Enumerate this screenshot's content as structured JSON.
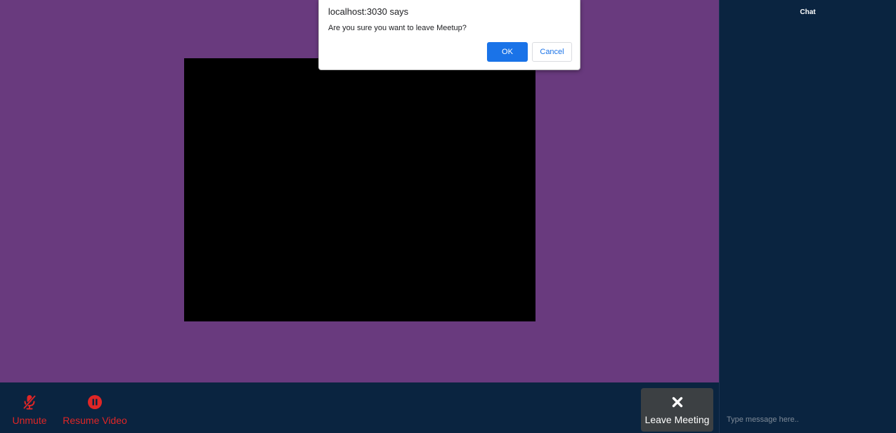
{
  "dialog": {
    "title": "localhost:3030 says",
    "message": "Are you sure you want to leave Meetup?",
    "ok_label": "OK",
    "cancel_label": "Cancel"
  },
  "controls": {
    "unmute": {
      "label": "Unmute",
      "icon": "microphone-off-icon"
    },
    "resume_video": {
      "label": "Resume Video",
      "icon": "pause-circle-icon"
    },
    "leave": {
      "label": "Leave Meeting",
      "icon": "close-icon"
    }
  },
  "chat": {
    "title": "Chat",
    "input_placeholder": "Type message here.."
  },
  "colors": {
    "meeting_background": "#693a7e",
    "panel_background": "#0a2440",
    "control_active_red": "#e02626",
    "dialog_primary_blue": "#1a73e8"
  }
}
